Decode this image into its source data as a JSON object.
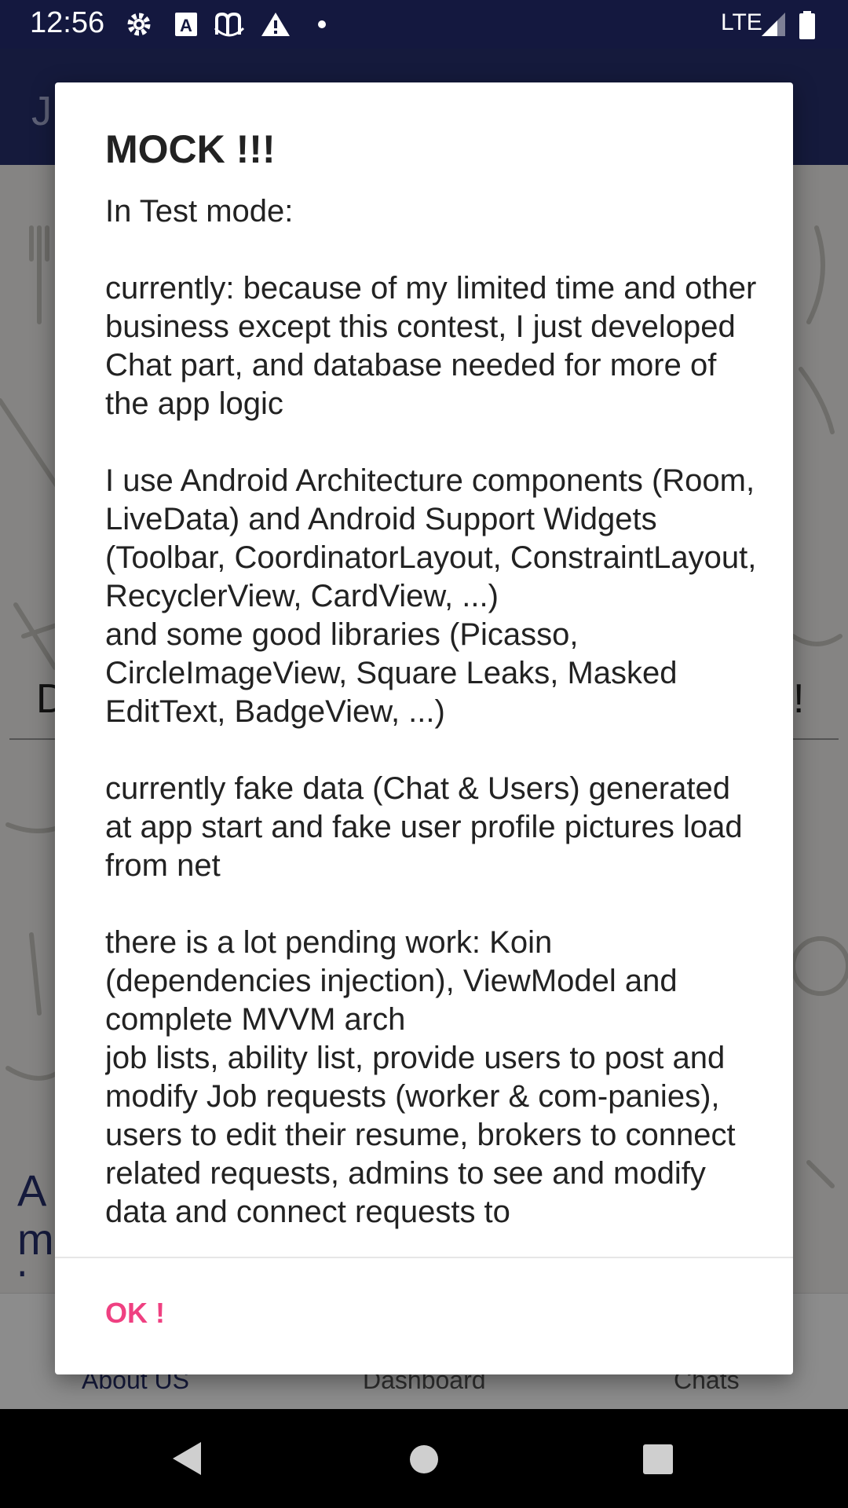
{
  "status_bar": {
    "time": "12:56",
    "network": "LTE",
    "icons": [
      "gear-icon",
      "font-a-icon",
      "m-app-icon",
      "warning-icon",
      "dot-icon",
      "signal-icon",
      "battery-icon"
    ]
  },
  "app_bar": {
    "title_partial": "J"
  },
  "background": {
    "left_text": "D",
    "right_text": "!",
    "about_partial": "A\nm\nb"
  },
  "bottom_nav": {
    "items": [
      {
        "label": "About US",
        "active": true
      },
      {
        "label": "Dashboard",
        "active": false
      },
      {
        "label": "Chats",
        "active": false
      }
    ]
  },
  "dialog": {
    "title": "MOCK !!!",
    "body": "In Test mode:\n\ncurrently: because of my limited time and other business except this contest, I just developed Chat part, and database needed for more of the app logic\n\nI use Android Architecture components (Room, LiveData) and Android Support Widgets (Toolbar, CoordinatorLayout, ConstraintLayout, RecyclerView, CardView, ...)\nand some good libraries (Picasso, CircleImageView, Square Leaks, Masked EditText, BadgeView, ...)\n\ncurrently fake data (Chat & Users) generated at app start and fake user profile pictures load from net\n\nthere is a lot pending work: Koin (dependencies injection), ViewModel and complete MVVM arch\njob lists, ability list, provide users to post and modify Job requests (worker & com-panies), users to edit their resume, brokers to connect related requests, admins to see and modify data and connect requests to",
    "ok_label": "OK !"
  },
  "colors": {
    "status_bar": "#14183f",
    "app_bar": "#27306e",
    "accent": "#ef4081",
    "scrim": "rgba(0,0,0,0.45)"
  }
}
